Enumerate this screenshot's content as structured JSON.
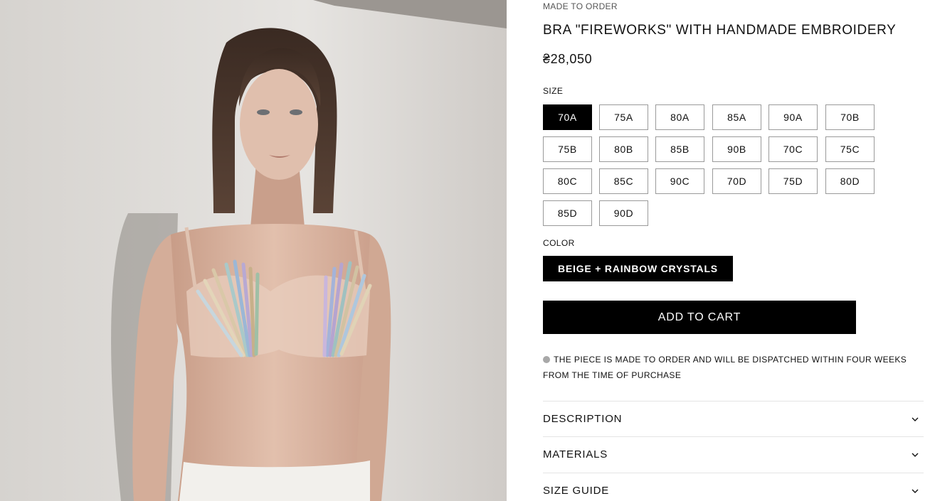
{
  "product": {
    "eyebrow": "MADE TO ORDER",
    "title": "BRA \"FIREWORKS\" WITH HANDMADE EMBROIDERY",
    "price": "₴28,050",
    "image_icon": "product-photo"
  },
  "size": {
    "label": "SIZE",
    "options": [
      "70A",
      "75A",
      "80A",
      "85A",
      "90A",
      "70B",
      "75B",
      "80B",
      "85B",
      "90B",
      "70C",
      "75C",
      "80C",
      "85C",
      "90C",
      "70D",
      "75D",
      "80D",
      "85D",
      "90D"
    ],
    "selected": "70A"
  },
  "color": {
    "label": "COLOR",
    "selected": "BEIGE + RAINBOW CRYSTALS"
  },
  "cart": {
    "add_label": "ADD TO CART"
  },
  "notice": {
    "text": "THE PIECE IS MADE TO ORDER AND WILL BE DISPATCHED WITHIN FOUR WEEKS FROM THE TIME OF PURCHASE"
  },
  "accordion": [
    {
      "label": "DESCRIPTION",
      "icon": "chevron-down-icon"
    },
    {
      "label": "MATERIALS",
      "icon": "chevron-down-icon"
    },
    {
      "label": "SIZE GUIDE",
      "icon": "chevron-down-icon"
    }
  ],
  "colors": {
    "accent": "#000000",
    "border": "#9a9a9a",
    "notice_dot": "#a8a8a8"
  }
}
